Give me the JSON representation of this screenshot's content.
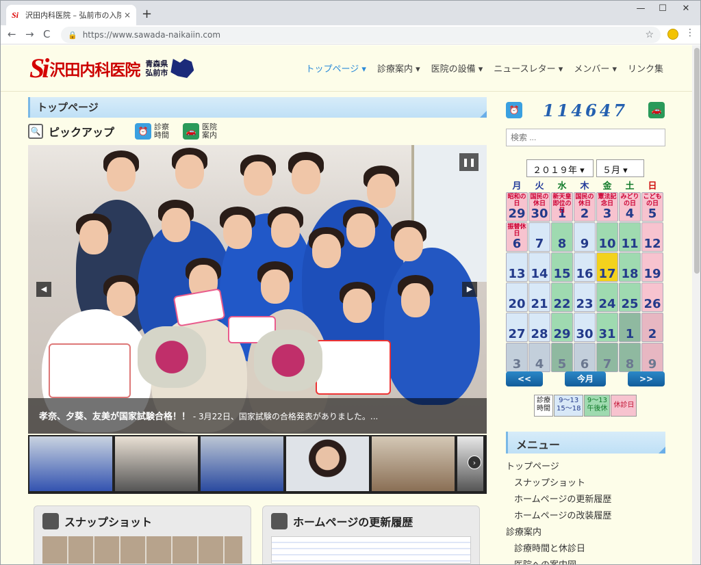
{
  "browser": {
    "tab_title": "沢田内科医院 – 弘前市の入院設備",
    "tab_close": "×",
    "new_tab": "+",
    "url": "https://www.sawada-naikaiin.com",
    "back": "←",
    "forward": "→",
    "reload": "C",
    "bookmark": "☆",
    "menu": "⋮",
    "minimize": "—",
    "maximize": "☐",
    "close": "✕"
  },
  "site": {
    "logo_mark": "Si",
    "logo_name": "沢田内科医院",
    "logo_pref": "青森県",
    "logo_city": "弘前市"
  },
  "gnav": [
    {
      "label": "トップページ ▾"
    },
    {
      "label": "診療案内 ▾"
    },
    {
      "label": "医院の設備 ▾"
    },
    {
      "label": "ニュースレター ▾"
    },
    {
      "label": "メンバー ▾"
    },
    {
      "label": "リンク集"
    }
  ],
  "main": {
    "page_title": "トップページ",
    "pickup_label": "ピックアップ",
    "hours_line1": "診察",
    "hours_line2": "時間",
    "guide_line1": "医院",
    "guide_line2": "案内",
    "pause": "❚❚",
    "prev": "◀",
    "next": "▶",
    "caption_title": "孝奈、夕葵、友美が国家試験合格！！",
    "caption_text": " - 3月22日、国家試験の合格発表がありました。...",
    "thumb_next": "›",
    "panel1_title": "スナップショット",
    "panel2_title": "ホームページの更新履歴"
  },
  "sidebar": {
    "counter": "114647",
    "search_placeholder": "検索 ...",
    "year_select": "２０１９年 ▾",
    "month_select": "５月 ▾",
    "weekdays": [
      "月",
      "火",
      "水",
      "木",
      "金",
      "土",
      "日"
    ],
    "weekday_colors": [
      "#223a9a",
      "#223a9a",
      "#117a2a",
      "#223a9a",
      "#117a2a",
      "#117a2a",
      "#d01010"
    ],
    "days": [
      {
        "d": "29",
        "h": "昭和の日",
        "bg": "#f7c3cf"
      },
      {
        "d": "30",
        "h": "国民の休日",
        "bg": "#f7c3cf"
      },
      {
        "d": "1",
        "h": "新天皇即位の日",
        "bg": "#f7c3cf"
      },
      {
        "d": "2",
        "h": "国民の休日",
        "bg": "#f7c3cf"
      },
      {
        "d": "3",
        "h": "憲法記念日",
        "bg": "#f7c3cf"
      },
      {
        "d": "4",
        "h": "みどりの日",
        "bg": "#f7c3cf"
      },
      {
        "d": "5",
        "h": "こどもの日",
        "bg": "#f7c3cf"
      },
      {
        "d": "6",
        "h": "振替休日",
        "bg": "#f7c3cf"
      },
      {
        "d": "7",
        "h": "",
        "bg": "#d8e8f7"
      },
      {
        "d": "8",
        "h": "",
        "bg": "#9fdab0"
      },
      {
        "d": "9",
        "h": "",
        "bg": "#d8e8f7"
      },
      {
        "d": "10",
        "h": "",
        "bg": "#9fdab0"
      },
      {
        "d": "11",
        "h": "",
        "bg": "#9fdab0"
      },
      {
        "d": "12",
        "h": "",
        "bg": "#f7c3cf"
      },
      {
        "d": "13",
        "h": "",
        "bg": "#d8e8f7"
      },
      {
        "d": "14",
        "h": "",
        "bg": "#d8e8f7"
      },
      {
        "d": "15",
        "h": "",
        "bg": "#9fdab0"
      },
      {
        "d": "16",
        "h": "",
        "bg": "#d8e8f7"
      },
      {
        "d": "17",
        "h": "",
        "bg": "#f3d21d"
      },
      {
        "d": "18",
        "h": "",
        "bg": "#9fdab0"
      },
      {
        "d": "19",
        "h": "",
        "bg": "#f7c3cf"
      },
      {
        "d": "20",
        "h": "",
        "bg": "#d8e8f7"
      },
      {
        "d": "21",
        "h": "",
        "bg": "#d8e8f7"
      },
      {
        "d": "22",
        "h": "",
        "bg": "#9fdab0"
      },
      {
        "d": "23",
        "h": "",
        "bg": "#d8e8f7"
      },
      {
        "d": "24",
        "h": "",
        "bg": "#9fdab0"
      },
      {
        "d": "25",
        "h": "",
        "bg": "#9fdab0"
      },
      {
        "d": "26",
        "h": "",
        "bg": "#f7c3cf"
      },
      {
        "d": "27",
        "h": "",
        "bg": "#d8e8f7"
      },
      {
        "d": "28",
        "h": "",
        "bg": "#d8e8f7"
      },
      {
        "d": "29",
        "h": "",
        "bg": "#9fdab0"
      },
      {
        "d": "30",
        "h": "",
        "bg": "#d8e8f7"
      },
      {
        "d": "31",
        "h": "",
        "bg": "#9fdab0"
      },
      {
        "d": "1",
        "h": "",
        "bg": "#8fb9a0"
      },
      {
        "d": "2",
        "h": "",
        "bg": "#e7b7c2"
      },
      {
        "d": "3",
        "h": "",
        "bg": "#c3cfdb"
      },
      {
        "d": "4",
        "h": "",
        "bg": "#c3cfdb"
      },
      {
        "d": "5",
        "h": "",
        "bg": "#8fb9a0"
      },
      {
        "d": "6",
        "h": "",
        "bg": "#c3cfdb"
      },
      {
        "d": "7",
        "h": "",
        "bg": "#8fb9a0"
      },
      {
        "d": "8",
        "h": "",
        "bg": "#8fb9a0"
      },
      {
        "d": "9",
        "h": "",
        "bg": "#e7b7c2"
      }
    ],
    "prev_month": "<<",
    "this_month": "今月",
    "next_month": ">>",
    "legend": [
      {
        "l1": "診療",
        "l2": "時間",
        "bg": "#fff",
        "color": "#222"
      },
      {
        "l1": "9～13",
        "l2": "15～18",
        "bg": "#d8e8f7",
        "color": "#233a8a"
      },
      {
        "l1": "9～13",
        "l2": "午後休",
        "bg": "#9fdab0",
        "color": "#117a2a"
      },
      {
        "l1": "休診日",
        "l2": "",
        "bg": "#f7c3cf",
        "color": "#c01030"
      }
    ],
    "menu_title": "メニュー",
    "menu_items": [
      {
        "label": "トップページ",
        "sub": false
      },
      {
        "label": "スナップショット",
        "sub": true
      },
      {
        "label": "ホームページの更新履歴",
        "sub": true
      },
      {
        "label": "ホームページの改装履歴",
        "sub": true
      },
      {
        "label": "診療案内",
        "sub": false
      },
      {
        "label": "診療時間と休診日",
        "sub": true
      },
      {
        "label": "医院への案内図",
        "sub": true
      }
    ]
  },
  "colors": {
    "page_bg": "#fdfde9",
    "accent": "#2a8ad8",
    "title_bar": "#bfe0f6",
    "brand_red": "#d40000"
  }
}
